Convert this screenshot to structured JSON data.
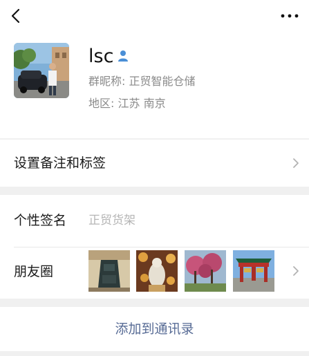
{
  "header": {
    "back_icon": "chevron-left-icon",
    "more_icon": "ellipsis-icon"
  },
  "profile": {
    "name": "lsc",
    "badge_icon": "person-icon",
    "group_nickname": "群昵称: 正贸智能仓储",
    "region": "地区: 江苏  南京"
  },
  "remark_row": {
    "label": "设置备注和标签"
  },
  "signature_row": {
    "label": "个性签名",
    "value": "正贸货架"
  },
  "moments_row": {
    "label": "朋友圈",
    "photos": [
      "bell-photo",
      "buddha-photo",
      "trees-photo",
      "gate-photo"
    ]
  },
  "actions": {
    "add_contact": "添加到通讯录"
  },
  "colors": {
    "link": "#576b95",
    "badge": "#4a8fd6",
    "bg": "#f0f0f0"
  }
}
